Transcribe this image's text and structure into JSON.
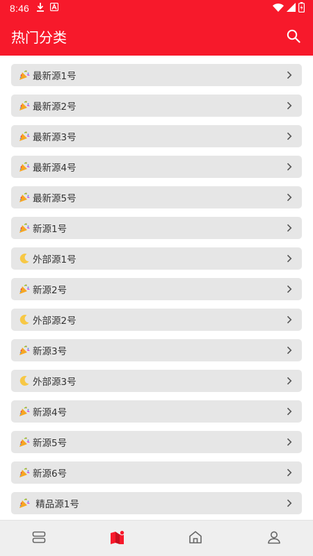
{
  "status_bar": {
    "time": "8:46",
    "icons": [
      "download-icon",
      "a-app-icon",
      "wifi-icon",
      "signal-icon",
      "battery-icon"
    ]
  },
  "app_bar": {
    "title": "热门分类",
    "search_icon": "search-icon"
  },
  "categories": [
    {
      "label": "最新源1号",
      "icon": "party-popper-icon"
    },
    {
      "label": "最新源2号",
      "icon": "party-popper-icon"
    },
    {
      "label": "最新源3号",
      "icon": "party-popper-icon"
    },
    {
      "label": "最新源4号",
      "icon": "party-popper-icon"
    },
    {
      "label": "最新源5号",
      "icon": "party-popper-icon"
    },
    {
      "label": "新源1号",
      "icon": "party-popper-icon"
    },
    {
      "label": "外部源1号",
      "icon": "crescent-moon-icon"
    },
    {
      "label": "新源2号",
      "icon": "party-popper-icon"
    },
    {
      "label": "外部源2号",
      "icon": "crescent-moon-icon"
    },
    {
      "label": "新源3号",
      "icon": "party-popper-icon"
    },
    {
      "label": "外部源3号",
      "icon": "crescent-moon-icon"
    },
    {
      "label": "新源4号",
      "icon": "party-popper-icon"
    },
    {
      "label": "新源5号",
      "icon": "party-popper-icon"
    },
    {
      "label": "新源6号",
      "icon": "party-popper-icon"
    },
    {
      "label": " 精品源1号",
      "icon": "party-popper-icon"
    }
  ],
  "bottom_nav": [
    {
      "name": "bookshelf-tab",
      "icon": "stack-icon",
      "active": false
    },
    {
      "name": "category-tab",
      "icon": "book-icon",
      "active": true
    },
    {
      "name": "home-tab",
      "icon": "home-icon",
      "active": false
    },
    {
      "name": "profile-tab",
      "icon": "person-icon",
      "active": false
    }
  ],
  "colors": {
    "primary": "#f7192b",
    "item_bg": "#e6e6e6",
    "nav_bg": "#efefef",
    "inactive_icon": "#666666"
  }
}
